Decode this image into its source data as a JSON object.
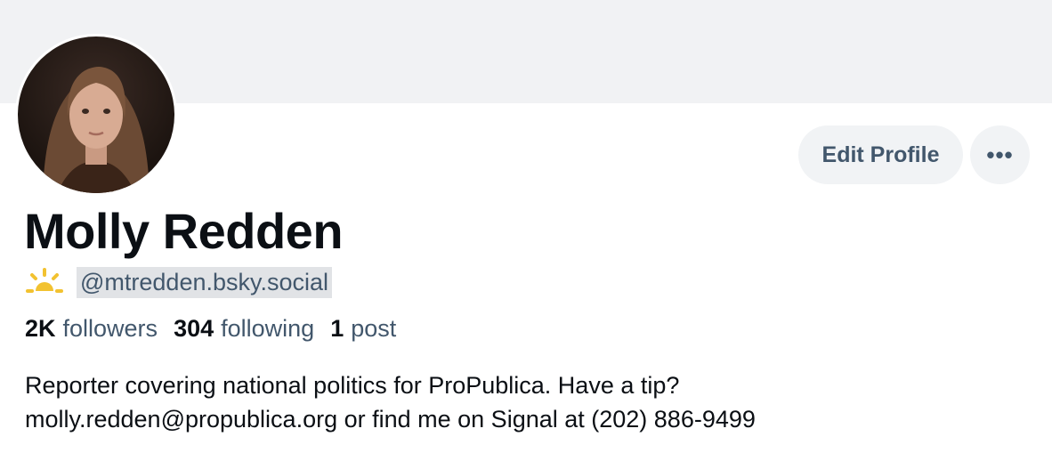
{
  "profile": {
    "display_name": "Molly Redden",
    "handle": "@mtredden.bsky.social",
    "avatar": "avatar-photo",
    "handle_icon": "sun-icon",
    "stats": {
      "followers_count": "2K",
      "followers_label": "followers",
      "following_count": "304",
      "following_label": "following",
      "posts_count": "1",
      "posts_label": "post"
    },
    "bio_line1": "Reporter covering national politics for ProPublica. Have a tip?",
    "bio_email": "molly.redden@propublica.org",
    "bio_line2_rest": " or find me on Signal at (202) 886-9499"
  },
  "actions": {
    "edit_label": "Edit Profile",
    "more_label": "•••",
    "more_icon": "ellipsis-icon"
  },
  "colors": {
    "banner": "#f1f2f4",
    "button_bg": "#f1f3f5",
    "muted_text": "#42576c",
    "handle_highlight": "#e1e3e6",
    "sun": "#f2c230"
  }
}
